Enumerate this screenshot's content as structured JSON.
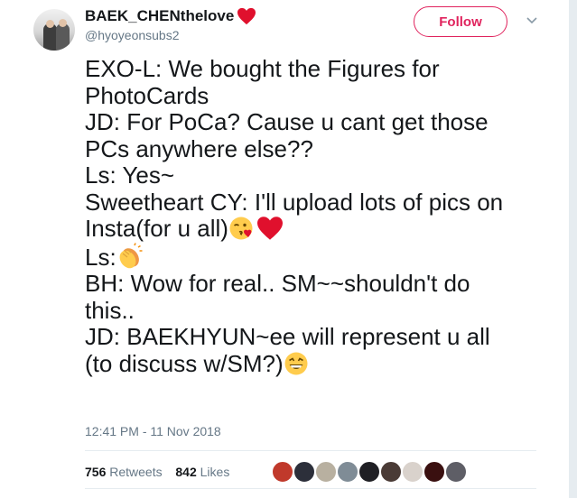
{
  "user": {
    "display_name": "BAEK_CHENthelove",
    "handle": "@hyoyeonsubs2",
    "name_emoji": "red-heart-icon"
  },
  "follow_button": {
    "label": "Follow",
    "color": "#e0245e"
  },
  "tweet": {
    "lines": [
      "EXO-L: We bought the Figures for",
      "PhotoCards",
      "JD: For PoCa? Cause u cant get those",
      "PCs anywhere else??",
      "Ls: Yes~",
      "Sweetheart CY: I'll upload lots of pics on",
      "Insta(for u all)",
      "Ls:",
      "BH: Wow for real.. SM~~shouldn't do",
      "this..",
      "JD: BAEKHYUN~ee will represent u all",
      "(to discuss w/SM?)"
    ],
    "emojis": [
      "kiss-wink-icon",
      "red-heart-icon",
      "clapping-hands-icon",
      "grinning-face-icon"
    ]
  },
  "timestamp": "12:41 PM - 11 Nov 2018",
  "stats": {
    "retweets_count": "756",
    "retweets_label": "Retweets",
    "likes_count": "842",
    "likes_label": "Likes"
  },
  "likers": [
    {
      "color": "#c0392b"
    },
    {
      "color": "#2c2f3a"
    },
    {
      "color": "#b8b0a0"
    },
    {
      "color": "#7f8c96"
    },
    {
      "color": "#1f1f24"
    },
    {
      "color": "#4a3b36"
    },
    {
      "color": "#d9d2cc"
    },
    {
      "color": "#3a1010"
    },
    {
      "color": "#5e5e66"
    }
  ]
}
